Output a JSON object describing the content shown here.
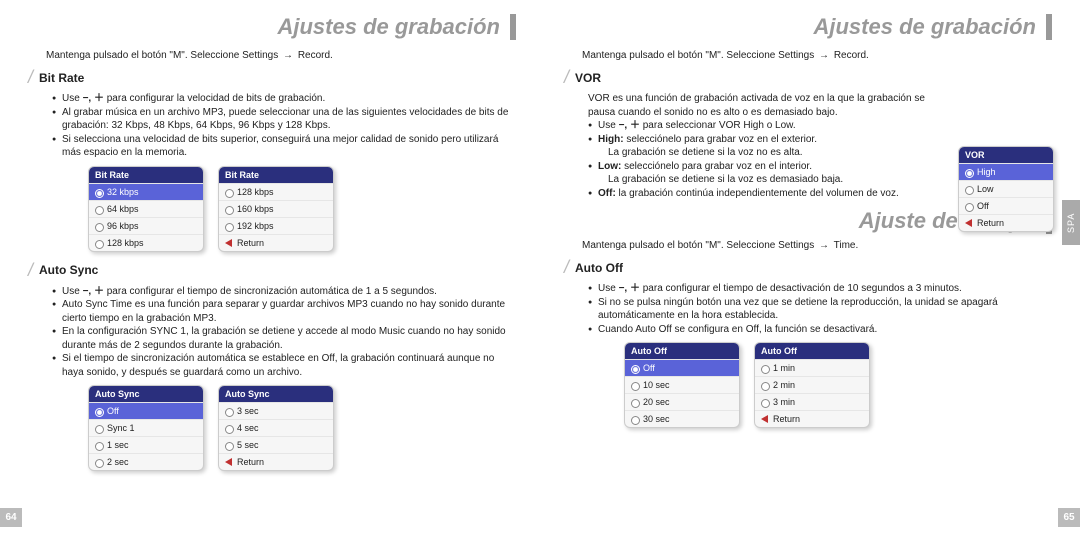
{
  "leftPage": {
    "title": "Ajustes de grabación",
    "intro_pre": "Mantenga pulsado el botón \"M\". Seleccione Settings",
    "intro_post": "Record.",
    "pageNum": "64",
    "sections": {
      "bitrate": {
        "head": "Bit Rate",
        "b1_pre": "Use ",
        "b1_post": " para configurar la velocidad de bits de grabación.",
        "b2": "Al grabar música en un archivo MP3, puede seleccionar una de las siguientes velocidades de bits de grabación: 32 Kbps, 48 Kbps, 64 Kbps, 96 Kbps y 128 Kbps.",
        "b3": "Si selecciona una velocidad de bits superior, conseguirá una mejor calidad de sonido pero utilizará más espacio en la memoria.",
        "menu1": {
          "title": "Bit Rate",
          "items": [
            "32 kbps",
            "64 kbps",
            "96 kbps",
            "128 kbps"
          ],
          "selected": 0,
          "hasReturn": false
        },
        "menu2": {
          "title": "Bit Rate",
          "items": [
            "128 kbps",
            "160 kbps",
            "192 kbps"
          ],
          "hasReturn": true
        }
      },
      "autosync": {
        "head": "Auto Sync",
        "b1_pre": "Use ",
        "b1_post": " para configurar el tiempo de sincronización automática de 1 a 5 segundos.",
        "b2": "Auto Sync Time es una función para separar y guardar archivos MP3 cuando no hay sonido durante cierto tiempo en la grabación MP3.",
        "b3": "En la configuración SYNC 1, la grabación se detiene y accede al modo Music cuando no hay sonido durante más de 2 segundos durante la grabación.",
        "b4": "Si el tiempo de sincronización automática se establece en Off, la grabación continuará aunque no haya sonido, y después se guardará como un archivo.",
        "menu1": {
          "title": "Auto Sync",
          "items": [
            "Off",
            "Sync 1",
            "1 sec",
            "2 sec"
          ],
          "selected": 0,
          "hasReturn": false
        },
        "menu2": {
          "title": "Auto Sync",
          "items": [
            "3 sec",
            "4 sec",
            "5 sec"
          ],
          "hasReturn": true
        }
      }
    }
  },
  "rightPage": {
    "title1": "Ajustes de grabación",
    "intro1_pre": "Mantenga pulsado el botón \"M\". Seleccione Settings",
    "intro1_post": "Record.",
    "title2": "Ajuste de tiempo",
    "intro2_pre": "Mantenga pulsado el botón \"M\". Seleccione Settings",
    "intro2_post": "Time.",
    "pageNum": "65",
    "sideTab": "SPA",
    "sections": {
      "vor": {
        "head": "VOR",
        "desc": "VOR es una función de grabación activada de voz en la que la grabación se pausa cuando el sonido no es alto o es demasiado bajo.",
        "b1_pre": "Use ",
        "b1_post": " para seleccionar VOR High o Low.",
        "b2_label": "High:",
        "b2_text": " selecciónelo para grabar voz en el exterior.",
        "b2_sub": "La grabación se detiene si la voz no es alta.",
        "b3_label": "Low:",
        "b3_text": " selecciónelo para grabar voz en el interior.",
        "b3_sub": "La grabación se detiene si la voz es demasiado baja.",
        "b4_label": "Off:",
        "b4_text": " la grabación continúa independientemente del volumen de voz.",
        "menu": {
          "title": "VOR",
          "items": [
            "High",
            "Low",
            "Off"
          ],
          "selected": 0,
          "hasReturn": true
        }
      },
      "autooff": {
        "head": "Auto Off",
        "b1_pre": "Use ",
        "b1_post": " para configurar el tiempo de desactivación de 10 segundos a 3 minutos.",
        "b2": "Si no se pulsa ningún botón una vez que se detiene la reproducción, la unidad se apagará automáticamente en la hora establecida.",
        "b3": "Cuando Auto Off se configura en Off, la función se desactivará.",
        "menu1": {
          "title": "Auto Off",
          "items": [
            "Off",
            "10 sec",
            "20 sec",
            "30 sec"
          ],
          "selected": 0,
          "hasReturn": false
        },
        "menu2": {
          "title": "Auto Off",
          "items": [
            "1 min",
            "2 min",
            "3 min"
          ],
          "hasReturn": true
        }
      }
    }
  },
  "ui": {
    "returnLabel": "Return"
  }
}
